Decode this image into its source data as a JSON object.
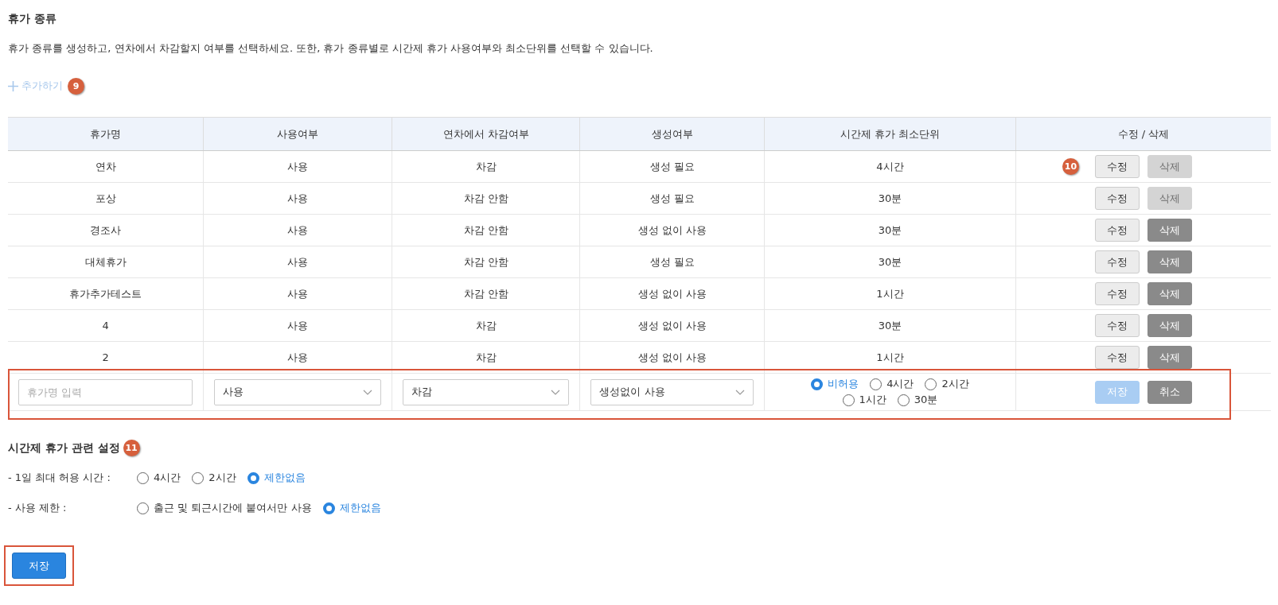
{
  "section": {
    "title": "휴가 종류",
    "description": "휴가 종류를 생성하고, 연차에서 차감할지 여부를 선택하세요. 또한, 휴가 종류별로 시간제 휴가 사용여부와 최소단위를 선택할 수 있습니다.",
    "add_label": "추가하기",
    "add_badge": "9"
  },
  "table": {
    "columns": [
      "휴가명",
      "사용여부",
      "연차에서 차감여부",
      "생성여부",
      "시간제 휴가 최소단위",
      "수정 / 삭제"
    ],
    "rows": [
      {
        "name": "연차",
        "use": "사용",
        "deduct": "차감",
        "create": "생성 필요",
        "unit": "4시간",
        "edit_label": "수정",
        "delete_label": "삭제",
        "delete_disabled": true,
        "badge": "10"
      },
      {
        "name": "포상",
        "use": "사용",
        "deduct": "차감 안함",
        "create": "생성 필요",
        "unit": "30분",
        "edit_label": "수정",
        "delete_label": "삭제",
        "delete_disabled": true
      },
      {
        "name": "경조사",
        "use": "사용",
        "deduct": "차감 안함",
        "create": "생성 없이 사용",
        "unit": "30분",
        "edit_label": "수정",
        "delete_label": "삭제",
        "delete_disabled": false
      },
      {
        "name": "대체휴가",
        "use": "사용",
        "deduct": "차감 안함",
        "create": "생성 필요",
        "unit": "30분",
        "edit_label": "수정",
        "delete_label": "삭제",
        "delete_disabled": false
      },
      {
        "name": "휴가추가테스트",
        "use": "사용",
        "deduct": "차감 안함",
        "create": "생성 없이 사용",
        "unit": "1시간",
        "edit_label": "수정",
        "delete_label": "삭제",
        "delete_disabled": false
      },
      {
        "name": "4",
        "use": "사용",
        "deduct": "차감",
        "create": "생성 없이 사용",
        "unit": "30분",
        "edit_label": "수정",
        "delete_label": "삭제",
        "delete_disabled": false
      },
      {
        "name": "2",
        "use": "사용",
        "deduct": "차감",
        "create": "생성 없이 사용",
        "unit": "1시간",
        "edit_label": "수정",
        "delete_label": "삭제",
        "delete_disabled": false
      }
    ],
    "new_row": {
      "highlighted": true,
      "name_placeholder": "휴가명 입력",
      "use_value": "사용",
      "deduct_value": "차감",
      "create_value": "생성없이 사용",
      "unit_options": [
        {
          "label": "비허용",
          "selected": true
        },
        {
          "label": "4시간",
          "selected": false
        },
        {
          "label": "2시간",
          "selected": false
        },
        {
          "label": "1시간",
          "selected": false
        },
        {
          "label": "30분",
          "selected": false
        }
      ],
      "save_label": "저장",
      "save_disabled": true,
      "cancel_label": "취소"
    }
  },
  "time_settings": {
    "title": "시간제 휴가 관련 설정",
    "badge": "11",
    "groups": [
      {
        "label": "- 1일 최대 허용 시간 :",
        "options": [
          {
            "label": "4시간",
            "selected": false
          },
          {
            "label": "2시간",
            "selected": false
          },
          {
            "label": "제한없음",
            "selected": true
          }
        ]
      },
      {
        "label": "- 사용 제한 :",
        "options": [
          {
            "label": "출근 및 퇴근시간에 붙여서만 사용",
            "selected": false
          },
          {
            "label": "제한없음",
            "selected": true
          }
        ]
      }
    ]
  },
  "save_button": {
    "label": "저장",
    "highlighted": true
  }
}
